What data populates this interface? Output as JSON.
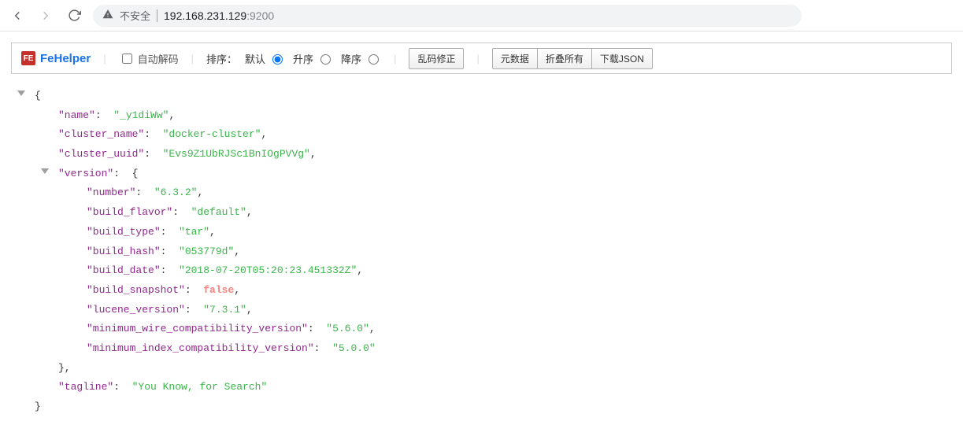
{
  "browser": {
    "insecure_label": "不安全",
    "url_host": "192.168.231.129",
    "url_port": ":9200"
  },
  "toolbar": {
    "brand": "FeHelper",
    "auto_decode": "自动解码",
    "sort_label": "排序：",
    "sort_default": "默认",
    "sort_asc": "升序",
    "sort_desc": "降序",
    "fix_encoding": "乱码修正",
    "meta_data": "元数据",
    "collapse_all": "折叠所有",
    "download_json": "下载JSON"
  },
  "json": {
    "name_k": "\"name\"",
    "name_v": "\"_y1diWw\"",
    "cluster_name_k": "\"cluster_name\"",
    "cluster_name_v": "\"docker-cluster\"",
    "cluster_uuid_k": "\"cluster_uuid\"",
    "cluster_uuid_v": "\"Evs9Z1UbRJSc1BnIOgPVVg\"",
    "version_k": "\"version\"",
    "number_k": "\"number\"",
    "number_v": "\"6.3.2\"",
    "build_flavor_k": "\"build_flavor\"",
    "build_flavor_v": "\"default\"",
    "build_type_k": "\"build_type\"",
    "build_type_v": "\"tar\"",
    "build_hash_k": "\"build_hash\"",
    "build_hash_v": "\"053779d\"",
    "build_date_k": "\"build_date\"",
    "build_date_v": "\"2018-07-20T05:20:23.451332Z\"",
    "build_snapshot_k": "\"build_snapshot\"",
    "build_snapshot_v": "false",
    "lucene_version_k": "\"lucene_version\"",
    "lucene_version_v": "\"7.3.1\"",
    "min_wire_k": "\"minimum_wire_compatibility_version\"",
    "min_wire_v": "\"5.6.0\"",
    "min_index_k": "\"minimum_index_compatibility_version\"",
    "min_index_v": "\"5.0.0\"",
    "tagline_k": "\"tagline\"",
    "tagline_v": "\"You Know, for Search\""
  }
}
